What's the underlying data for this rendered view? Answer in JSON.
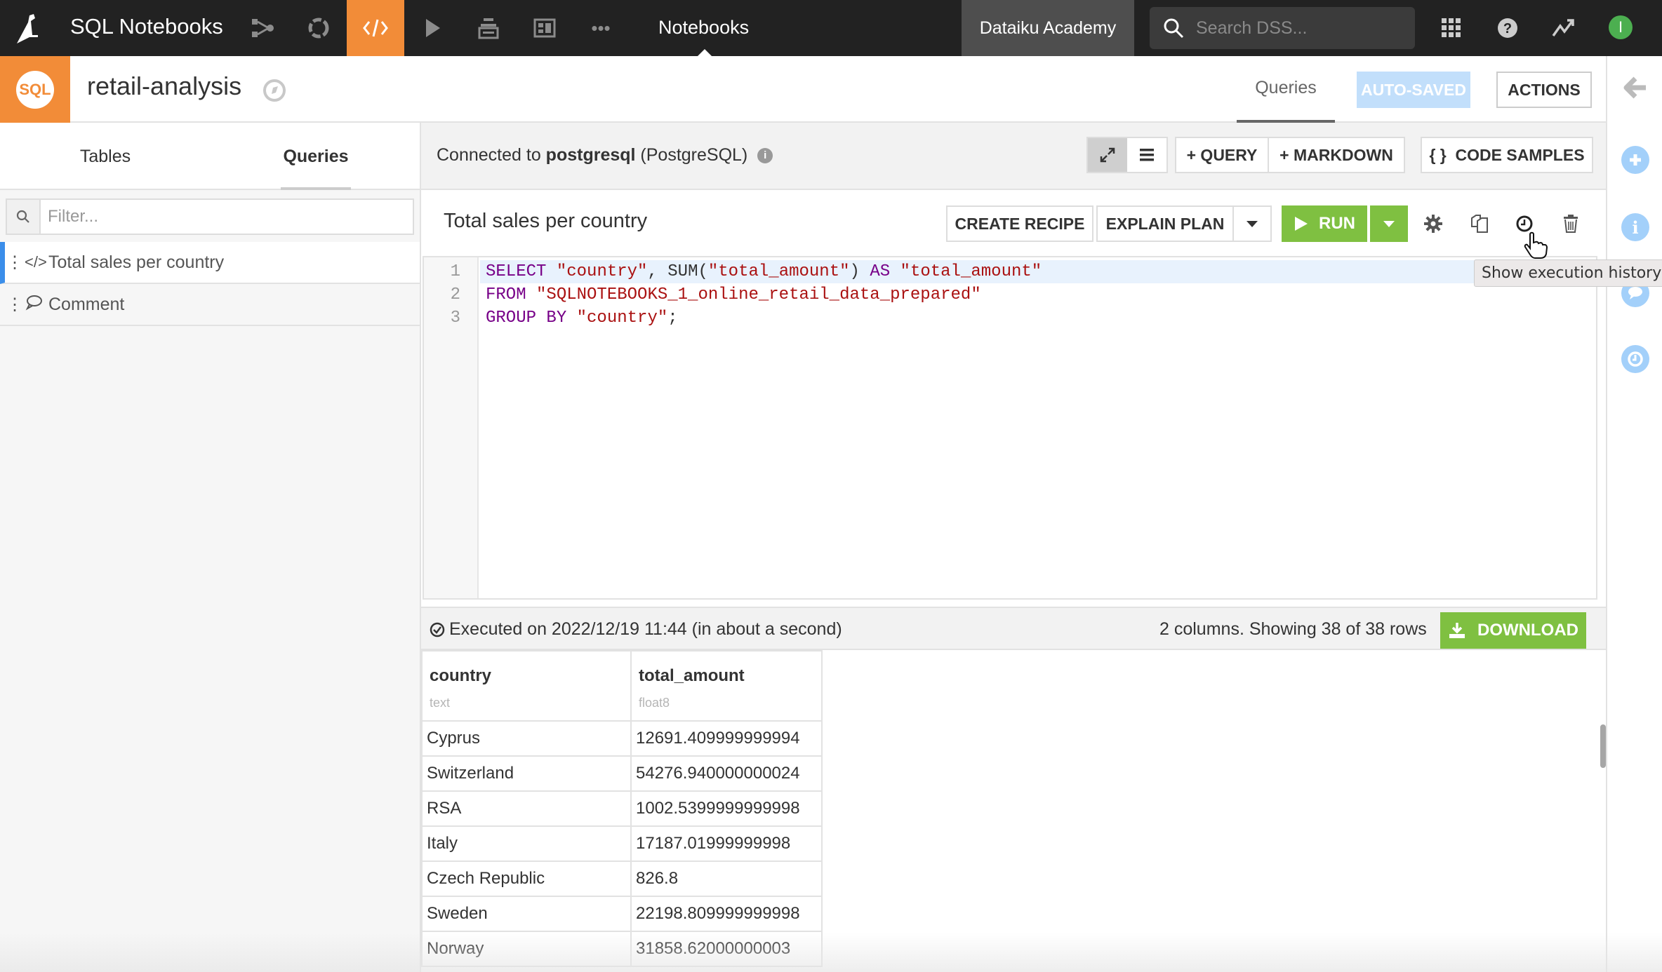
{
  "topbar": {
    "app_title": "SQL Notebooks",
    "nav_icons": [
      "flow-icon",
      "jobs-icon",
      "code-icon",
      "run-icon",
      "deploy-icon",
      "dashboard-icon",
      "more-icon"
    ],
    "active_nav": "code-icon",
    "section_label": "Notebooks",
    "instance_label": "Dataiku Academy",
    "search_placeholder": "Search DSS...",
    "avatar_initial": "I"
  },
  "header": {
    "badge": "SQL",
    "notebook_name": "retail-analysis",
    "tab_queries": "Queries",
    "autosaved_label": "AUTO-SAVED",
    "actions_label": "ACTIONS"
  },
  "sidebar": {
    "tabs": [
      {
        "label": "Tables",
        "active": false
      },
      {
        "label": "Queries",
        "active": true
      }
    ],
    "filter_placeholder": "Filter...",
    "items": [
      {
        "type": "query",
        "label": "Total sales per country",
        "active": true
      },
      {
        "type": "comment",
        "label": "Comment",
        "active": false
      }
    ]
  },
  "toolbar": {
    "connected_prefix": "Connected to ",
    "connection_name": "postgresql",
    "connection_type": " (PostgreSQL)",
    "add_query_label": "+ QUERY",
    "add_markdown_label": "+ MARKDOWN",
    "code_samples_label": "{ }  CODE SAMPLES"
  },
  "query": {
    "title": "Total sales per country",
    "create_recipe_label": "CREATE RECIPE",
    "explain_plan_label": "EXPLAIN PLAN",
    "run_label": "RUN",
    "tooltip": "Show execution history",
    "code_lines": [
      {
        "num": "1",
        "tokens": [
          [
            "kw",
            "SELECT "
          ],
          [
            "str",
            "\"country\""
          ],
          [
            "plain",
            ", SUM("
          ],
          [
            "str",
            "\"total_amount\""
          ],
          [
            "plain",
            ") "
          ],
          [
            "kw",
            "AS "
          ],
          [
            "str",
            "\"total_amount\""
          ]
        ]
      },
      {
        "num": "2",
        "tokens": [
          [
            "kw",
            "FROM "
          ],
          [
            "str",
            "\"SQLNOTEBOOKS_1_online_retail_data_prepared\""
          ]
        ]
      },
      {
        "num": "3",
        "tokens": [
          [
            "kw",
            "GROUP BY "
          ],
          [
            "str",
            "\"country\""
          ],
          [
            "plain",
            ";"
          ]
        ]
      }
    ]
  },
  "results": {
    "executed_text": "Executed on 2022/12/19 11:44 (in about a second)",
    "summary": "2 columns. Showing 38 of 38 rows",
    "download_label": "DOWNLOAD",
    "columns": [
      {
        "name": "country",
        "type": "text"
      },
      {
        "name": "total_amount",
        "type": "float8"
      }
    ],
    "rows": [
      [
        "Cyprus",
        "12691.409999999994"
      ],
      [
        "Switzerland",
        "54276.940000000024"
      ],
      [
        "RSA",
        "1002.5399999999998"
      ],
      [
        "Italy",
        "17187.01999999998"
      ],
      [
        "Czech Republic",
        "826.8"
      ],
      [
        "Sweden",
        "22198.809999999998"
      ],
      [
        "Norway",
        "31858.62000000003"
      ]
    ]
  },
  "rail": {
    "icons": [
      "back-arrow-icon",
      "add-icon",
      "info-icon",
      "discussion-icon",
      "history-icon"
    ]
  },
  "colors": {
    "accent_orange": "#f28c38",
    "run_green": "#7fc041",
    "rail_blue": "#a3d0fa",
    "active_item_blue": "#3b8eea"
  }
}
